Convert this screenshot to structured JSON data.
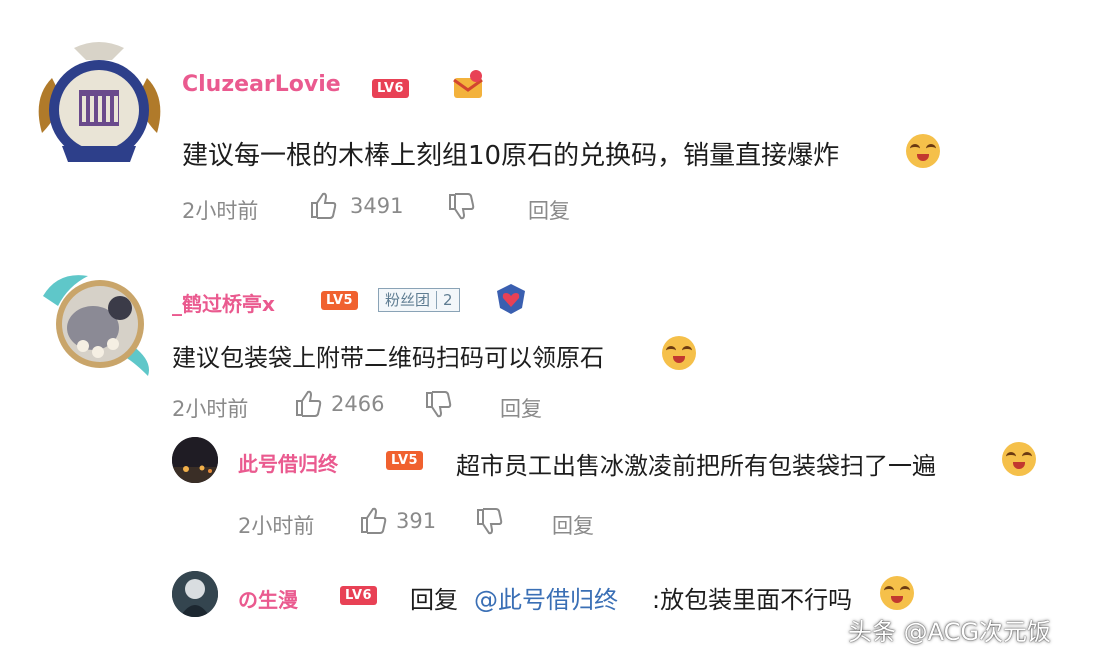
{
  "comments": [
    {
      "username": "CluzearLovie",
      "level": "LV6",
      "text": "建议每一根的木棒上刻组10原石的兑换码，销量直接爆炸",
      "time": "2小时前",
      "likes": "3491",
      "reply_label": "回复"
    },
    {
      "username": "_鹤过桥亭x",
      "level": "LV5",
      "fan_group": "粉丝团",
      "fan_level": "2",
      "text": "建议包装袋上附带二维码扫码可以领原石",
      "time": "2小时前",
      "likes": "2466",
      "reply_label": "回复"
    }
  ],
  "replies": [
    {
      "username": "此号借归终",
      "level": "LV5",
      "text": "超市员工出售冰激凌前把所有包装袋扫了一遍",
      "time": "2小时前",
      "likes": "391",
      "reply_label": "回复"
    },
    {
      "username": "の生漫",
      "level": "LV6",
      "reply_prefix": "回复",
      "mention": "@此号借归终",
      "text": ":放包装里面不行吗"
    }
  ],
  "watermark": "头条 @ACG次元饭",
  "colors": {
    "username": "#ea5a8f",
    "level_badge": "#f0612f",
    "meta": "#8a8a8a",
    "mention": "#3a6fb5"
  }
}
